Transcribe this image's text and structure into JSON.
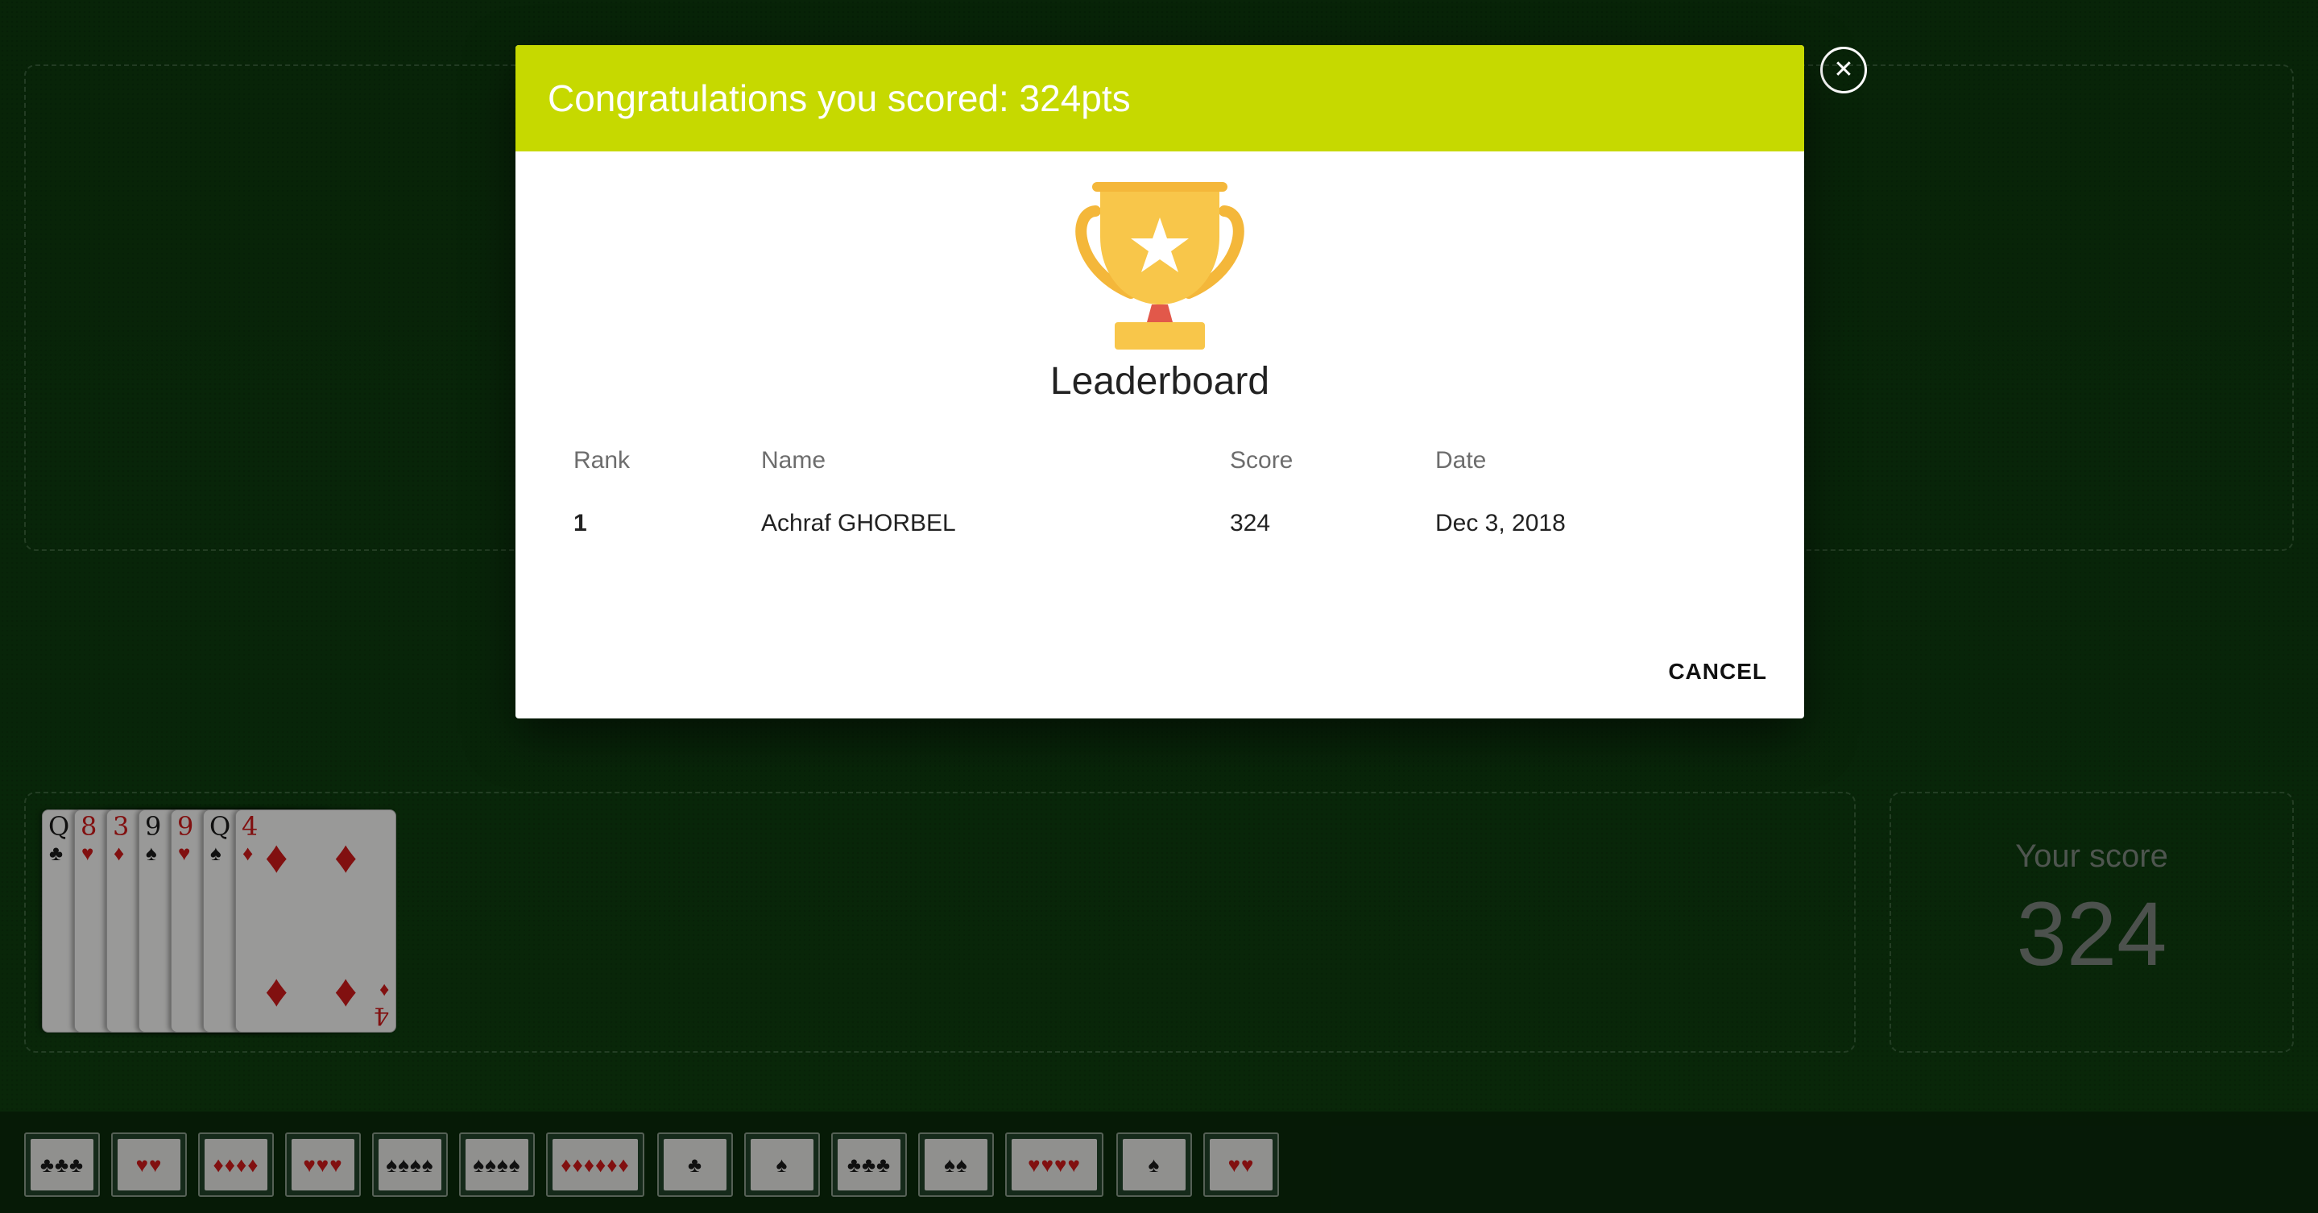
{
  "dialog": {
    "title": "Congratulations you scored: 324pts",
    "leaderboard_title": "Leaderboard",
    "columns": [
      "Rank",
      "Name",
      "Score",
      "Date"
    ],
    "rows": [
      {
        "rank": "1",
        "name": "Achraf GHORBEL",
        "score": "324",
        "date": "Dec 3, 2018"
      }
    ],
    "cancel_label": "CANCEL",
    "close_icon": "close-icon",
    "trophy_icon": "trophy-icon",
    "header_color": "#c6d900"
  },
  "score_panel": {
    "label": "Your score",
    "value": "324"
  },
  "hand": {
    "cards": [
      {
        "rank": "Q",
        "suit": "♣",
        "color": "black"
      },
      {
        "rank": "8",
        "suit": "♥",
        "color": "red"
      },
      {
        "rank": "3",
        "suit": "♦",
        "color": "red"
      },
      {
        "rank": "9",
        "suit": "♠",
        "color": "black"
      },
      {
        "rank": "9",
        "suit": "♥",
        "color": "red"
      },
      {
        "rank": "Q",
        "suit": "♠",
        "color": "black"
      },
      {
        "rank": "4",
        "suit": "♦",
        "color": "red"
      }
    ]
  },
  "tray": {
    "groups": [
      "♣♣♣",
      "♥♥",
      "♦♦♦♦",
      "♥♥♥",
      "♠♠♠♠",
      "♠♠♠♠",
      "♦♦♦♦♦♦",
      "♣",
      "♠",
      "♣♣♣",
      "♠♠",
      "♥♥♥♥",
      "♠",
      "♥♥"
    ]
  }
}
